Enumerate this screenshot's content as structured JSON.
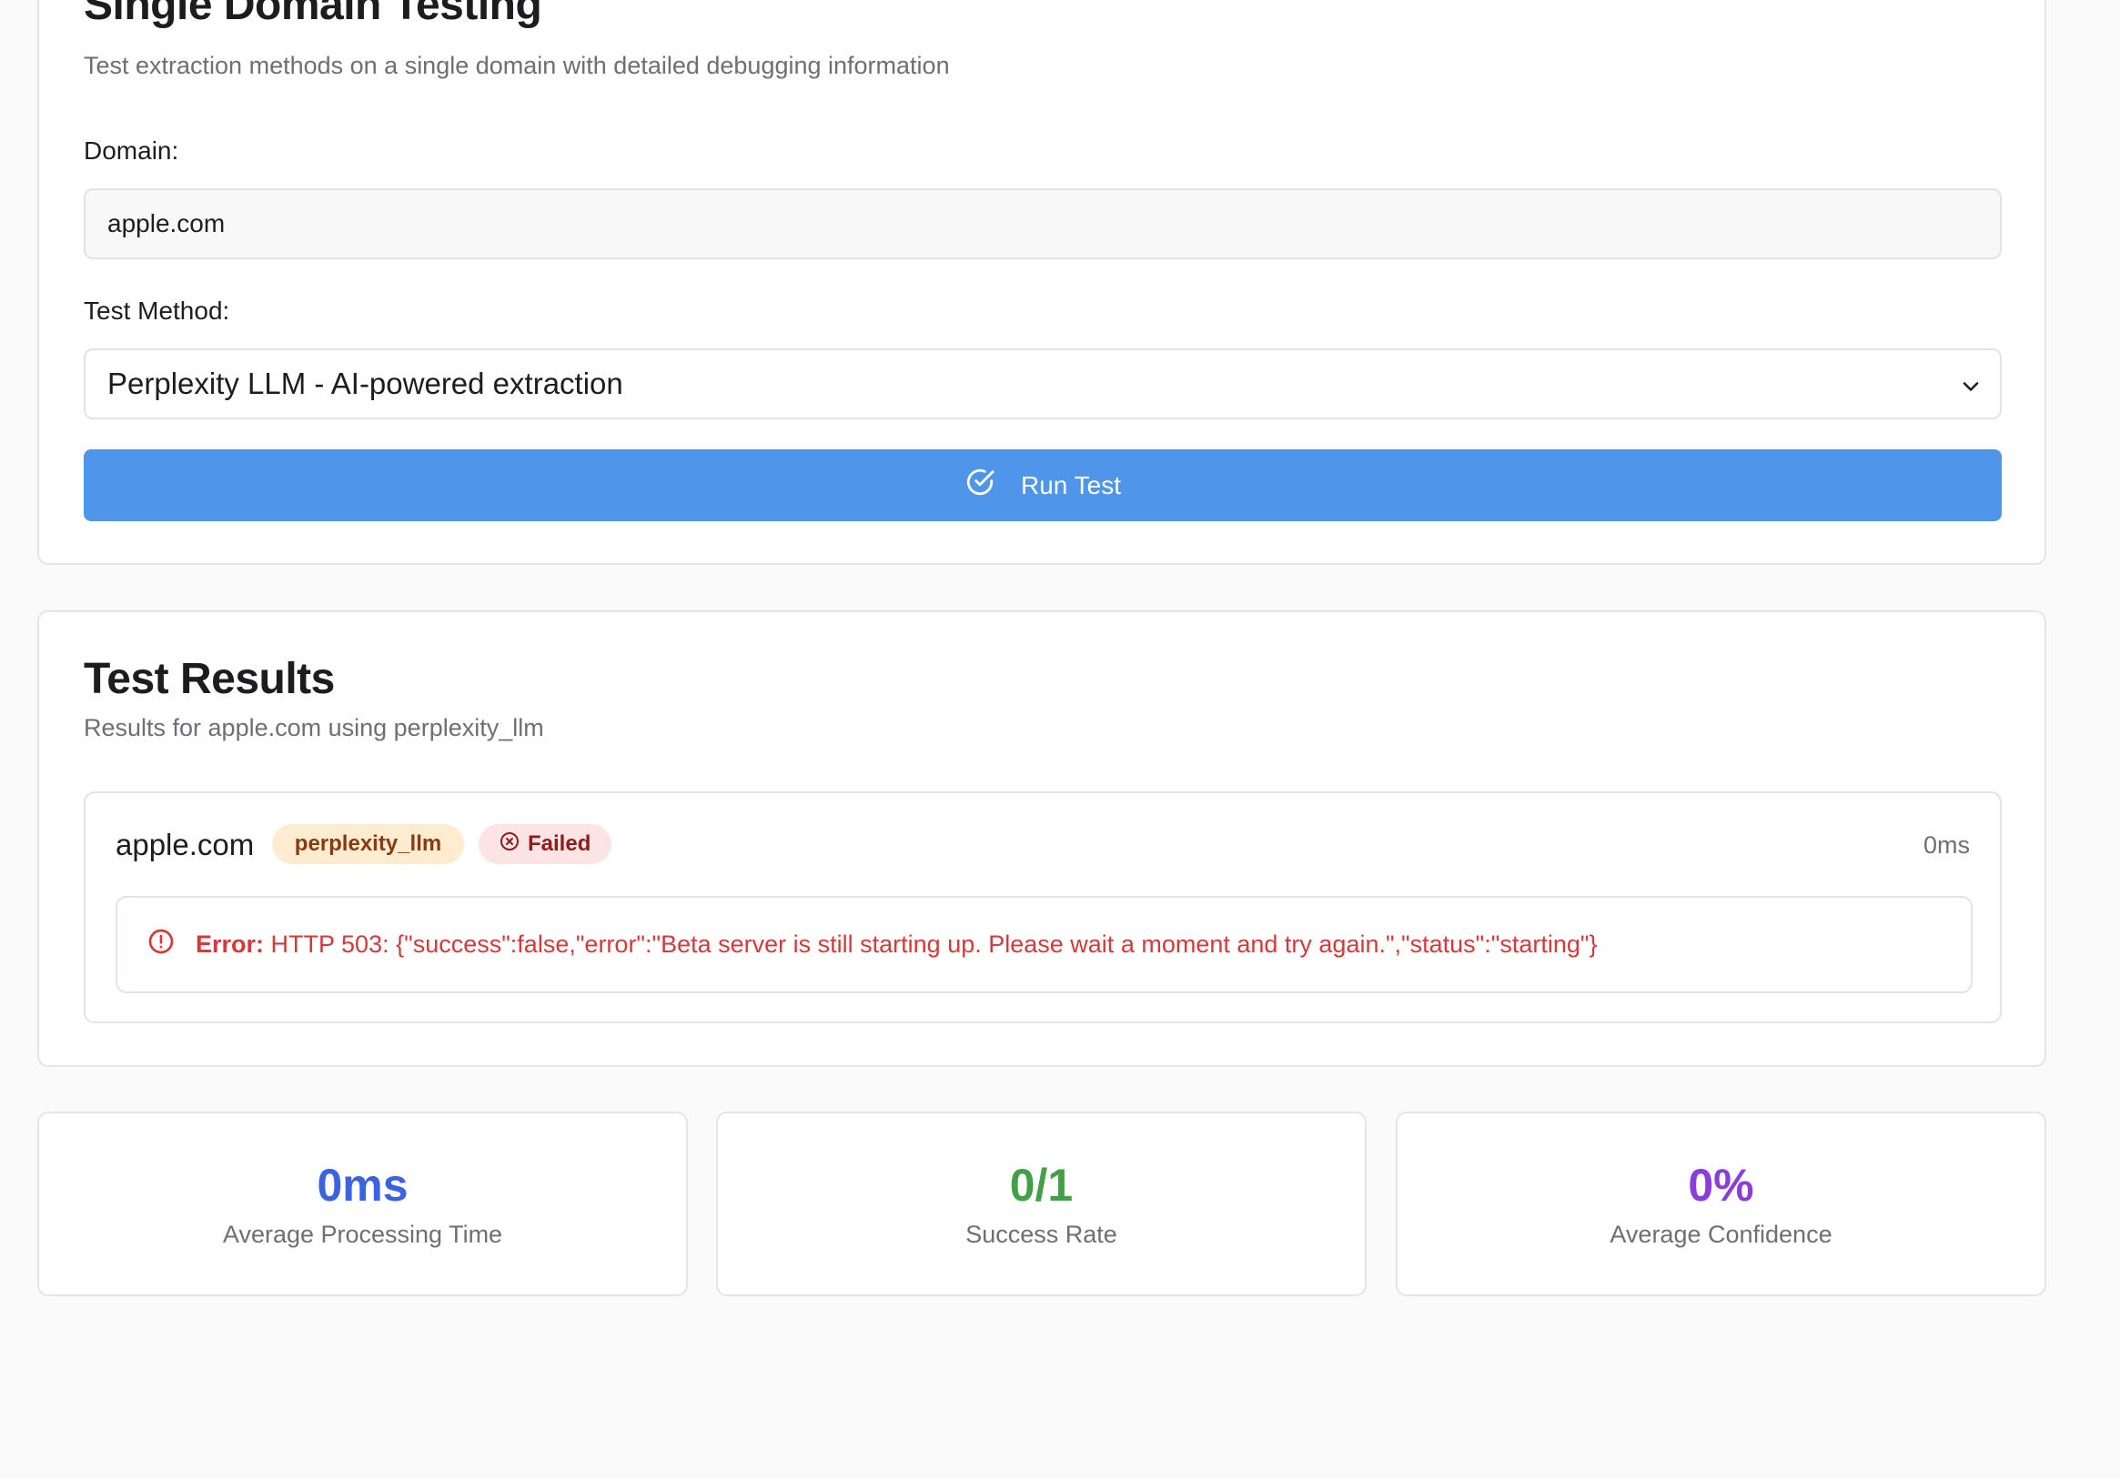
{
  "single": {
    "title": "Single Domain Testing",
    "subtitle": "Test extraction methods on a single domain with detailed debugging information",
    "domain_label": "Domain:",
    "domain_value": "apple.com",
    "method_label": "Test Method:",
    "method_selected": "Perplexity LLM - AI-powered extraction",
    "run_label": "Run Test"
  },
  "results": {
    "title": "Test Results",
    "subtitle": "Results for apple.com using perplexity_llm",
    "item": {
      "domain": "apple.com",
      "method_badge": "perplexity_llm",
      "status_badge": "Failed",
      "time": "0ms",
      "error_prefix": "Error:",
      "error_text": "HTTP 503: {\"success\":false,\"error\":\"Beta server is still starting up. Please wait a moment and try again.\",\"status\":\"starting\"}"
    }
  },
  "stats": [
    {
      "value": "0ms",
      "caption": "Average Processing Time",
      "color": "#3b63e0"
    },
    {
      "value": "0/1",
      "caption": "Success Rate",
      "color": "#44a047"
    },
    {
      "value": "0%",
      "caption": "Average Confidence",
      "color": "#8a3ddb"
    }
  ],
  "colors": {
    "accent": "#4f95e9",
    "error": "#d43a3a"
  },
  "icons": {
    "run": "check-circle-icon",
    "failed": "x-circle-icon",
    "error": "alert-circle-icon",
    "select": "chevron-down-icon"
  }
}
